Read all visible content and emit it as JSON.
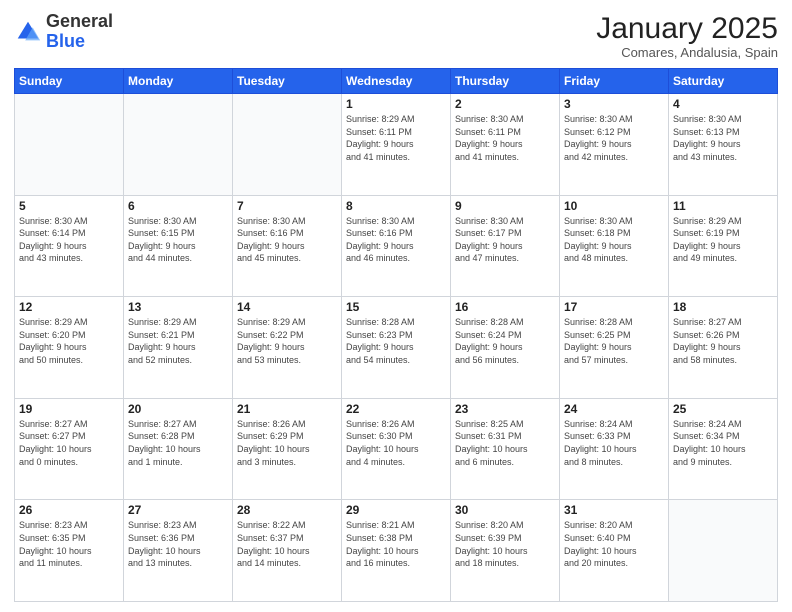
{
  "logo": {
    "general": "General",
    "blue": "Blue"
  },
  "header": {
    "month": "January 2025",
    "location": "Comares, Andalusia, Spain"
  },
  "weekdays": [
    "Sunday",
    "Monday",
    "Tuesday",
    "Wednesday",
    "Thursday",
    "Friday",
    "Saturday"
  ],
  "weeks": [
    [
      {
        "day": "",
        "info": ""
      },
      {
        "day": "",
        "info": ""
      },
      {
        "day": "",
        "info": ""
      },
      {
        "day": "1",
        "info": "Sunrise: 8:29 AM\nSunset: 6:11 PM\nDaylight: 9 hours\nand 41 minutes."
      },
      {
        "day": "2",
        "info": "Sunrise: 8:30 AM\nSunset: 6:11 PM\nDaylight: 9 hours\nand 41 minutes."
      },
      {
        "day": "3",
        "info": "Sunrise: 8:30 AM\nSunset: 6:12 PM\nDaylight: 9 hours\nand 42 minutes."
      },
      {
        "day": "4",
        "info": "Sunrise: 8:30 AM\nSunset: 6:13 PM\nDaylight: 9 hours\nand 43 minutes."
      }
    ],
    [
      {
        "day": "5",
        "info": "Sunrise: 8:30 AM\nSunset: 6:14 PM\nDaylight: 9 hours\nand 43 minutes."
      },
      {
        "day": "6",
        "info": "Sunrise: 8:30 AM\nSunset: 6:15 PM\nDaylight: 9 hours\nand 44 minutes."
      },
      {
        "day": "7",
        "info": "Sunrise: 8:30 AM\nSunset: 6:16 PM\nDaylight: 9 hours\nand 45 minutes."
      },
      {
        "day": "8",
        "info": "Sunrise: 8:30 AM\nSunset: 6:16 PM\nDaylight: 9 hours\nand 46 minutes."
      },
      {
        "day": "9",
        "info": "Sunrise: 8:30 AM\nSunset: 6:17 PM\nDaylight: 9 hours\nand 47 minutes."
      },
      {
        "day": "10",
        "info": "Sunrise: 8:30 AM\nSunset: 6:18 PM\nDaylight: 9 hours\nand 48 minutes."
      },
      {
        "day": "11",
        "info": "Sunrise: 8:29 AM\nSunset: 6:19 PM\nDaylight: 9 hours\nand 49 minutes."
      }
    ],
    [
      {
        "day": "12",
        "info": "Sunrise: 8:29 AM\nSunset: 6:20 PM\nDaylight: 9 hours\nand 50 minutes."
      },
      {
        "day": "13",
        "info": "Sunrise: 8:29 AM\nSunset: 6:21 PM\nDaylight: 9 hours\nand 52 minutes."
      },
      {
        "day": "14",
        "info": "Sunrise: 8:29 AM\nSunset: 6:22 PM\nDaylight: 9 hours\nand 53 minutes."
      },
      {
        "day": "15",
        "info": "Sunrise: 8:28 AM\nSunset: 6:23 PM\nDaylight: 9 hours\nand 54 minutes."
      },
      {
        "day": "16",
        "info": "Sunrise: 8:28 AM\nSunset: 6:24 PM\nDaylight: 9 hours\nand 56 minutes."
      },
      {
        "day": "17",
        "info": "Sunrise: 8:28 AM\nSunset: 6:25 PM\nDaylight: 9 hours\nand 57 minutes."
      },
      {
        "day": "18",
        "info": "Sunrise: 8:27 AM\nSunset: 6:26 PM\nDaylight: 9 hours\nand 58 minutes."
      }
    ],
    [
      {
        "day": "19",
        "info": "Sunrise: 8:27 AM\nSunset: 6:27 PM\nDaylight: 10 hours\nand 0 minutes."
      },
      {
        "day": "20",
        "info": "Sunrise: 8:27 AM\nSunset: 6:28 PM\nDaylight: 10 hours\nand 1 minute."
      },
      {
        "day": "21",
        "info": "Sunrise: 8:26 AM\nSunset: 6:29 PM\nDaylight: 10 hours\nand 3 minutes."
      },
      {
        "day": "22",
        "info": "Sunrise: 8:26 AM\nSunset: 6:30 PM\nDaylight: 10 hours\nand 4 minutes."
      },
      {
        "day": "23",
        "info": "Sunrise: 8:25 AM\nSunset: 6:31 PM\nDaylight: 10 hours\nand 6 minutes."
      },
      {
        "day": "24",
        "info": "Sunrise: 8:24 AM\nSunset: 6:33 PM\nDaylight: 10 hours\nand 8 minutes."
      },
      {
        "day": "25",
        "info": "Sunrise: 8:24 AM\nSunset: 6:34 PM\nDaylight: 10 hours\nand 9 minutes."
      }
    ],
    [
      {
        "day": "26",
        "info": "Sunrise: 8:23 AM\nSunset: 6:35 PM\nDaylight: 10 hours\nand 11 minutes."
      },
      {
        "day": "27",
        "info": "Sunrise: 8:23 AM\nSunset: 6:36 PM\nDaylight: 10 hours\nand 13 minutes."
      },
      {
        "day": "28",
        "info": "Sunrise: 8:22 AM\nSunset: 6:37 PM\nDaylight: 10 hours\nand 14 minutes."
      },
      {
        "day": "29",
        "info": "Sunrise: 8:21 AM\nSunset: 6:38 PM\nDaylight: 10 hours\nand 16 minutes."
      },
      {
        "day": "30",
        "info": "Sunrise: 8:20 AM\nSunset: 6:39 PM\nDaylight: 10 hours\nand 18 minutes."
      },
      {
        "day": "31",
        "info": "Sunrise: 8:20 AM\nSunset: 6:40 PM\nDaylight: 10 hours\nand 20 minutes."
      },
      {
        "day": "",
        "info": ""
      }
    ]
  ]
}
